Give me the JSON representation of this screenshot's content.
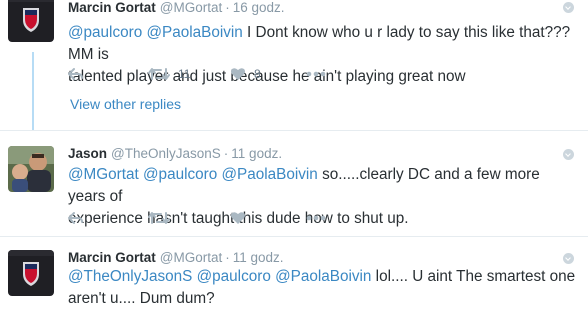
{
  "tweets": [
    {
      "name": "Marcin Gortat",
      "handle": "@MGortat",
      "time": "16 godz.",
      "line1": {
        "m1": "@paulcoro",
        "m2": "@PaolaBoivin",
        "rest": " I Dont know who u r lady to say this like that???MM is"
      },
      "line2": "talented player and just because he ain't playing great now",
      "retweets": "11",
      "likes": "8"
    },
    {
      "name": "Jason",
      "handle": "@TheOnlyJasonS",
      "time": "11 godz.",
      "line1": {
        "m1": "@MGortat",
        "m2": "@paulcoro",
        "m3": "@PaolaBoivin",
        "rest": " so.....clearly DC and a few more years of"
      },
      "line2": "experience hasn't taught this dude how to shut up.",
      "retweets": "",
      "likes": ""
    },
    {
      "name": "Marcin Gortat",
      "handle": "@MGortat",
      "time": "11 godz.",
      "line1": {
        "m1": "@TheOnlyJasonS",
        "m2": "@paulcoro",
        "m3": "@PaolaBoivin",
        "rest": " lol.... U aint The smartest one"
      },
      "line2": "aren't u.... Dum dum?"
    }
  ],
  "view_other_replies": "View other replies",
  "colors": {
    "link": "#3b88c3",
    "muted": "#8899a6",
    "thread": "#b7dcf5"
  },
  "icons": [
    "reply-icon",
    "retweet-icon",
    "like-icon",
    "more-icon",
    "caret-down-icon"
  ]
}
